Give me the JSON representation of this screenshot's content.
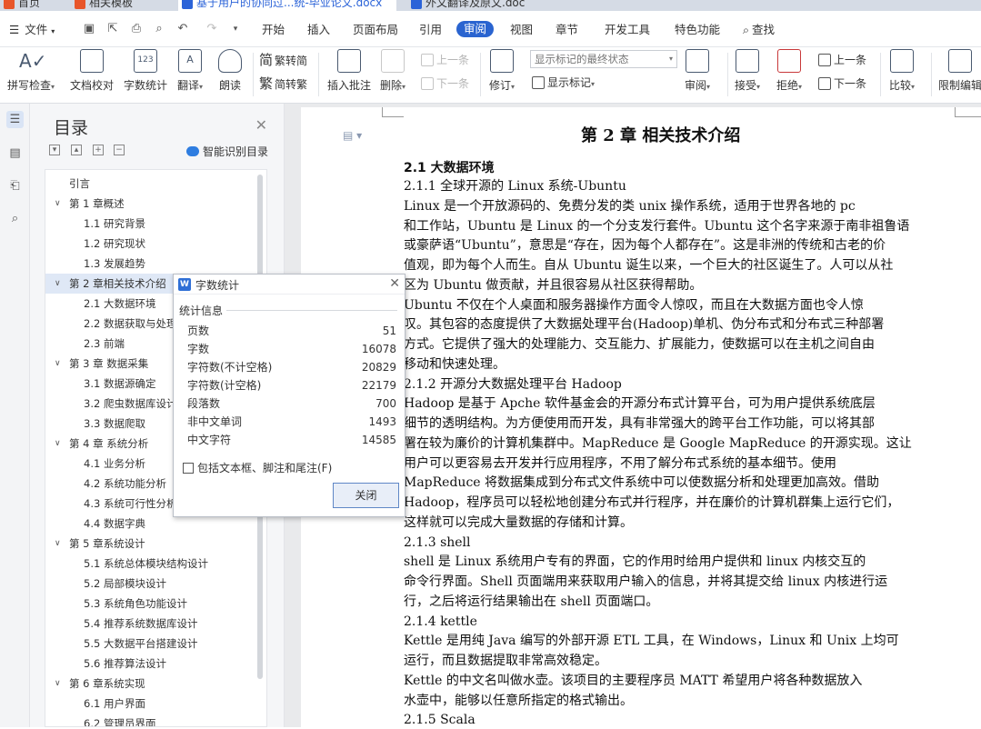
{
  "doc_tabs": [
    {
      "label": "首页",
      "color": "#e8562a"
    },
    {
      "label": "相关模板",
      "color": "#e8562a"
    },
    {
      "label": "基于用户的协同过...统-毕业论文.docx",
      "color": "#2b63d8"
    },
    {
      "label": "外文翻译及原文.doc",
      "color": "#2b63d8"
    }
  ],
  "menu": {
    "file_label": "文件",
    "items": [
      "开始",
      "插入",
      "页面布局",
      "引用",
      "审阅",
      "视图",
      "章节",
      "开发工具",
      "特色功能"
    ],
    "active": "审阅",
    "search_label": "查找"
  },
  "ribbon": {
    "spell_check": "拼写检查",
    "doc_proof": "文档校对",
    "word_count": "字数统计",
    "translate": "翻译",
    "read_aloud": "朗读",
    "trad_simp": "繁转简",
    "simp_trad": "简转繁",
    "insert_comment": "插入批注",
    "delete": "删除",
    "prev_comment": "上一条",
    "next_comment": "下一条",
    "revise": "修订",
    "markup_select_value": "显示标记的最终状态",
    "show_markup": "显示标记",
    "review": "审阅",
    "accept": "接受",
    "reject": "拒绝",
    "prev_change": "上一条",
    "next_change": "下一条",
    "compare": "比较",
    "restrict_edit": "限制编辑"
  },
  "toc": {
    "title": "目录",
    "smart_label": "智能识别目录",
    "items": [
      {
        "label": "引言",
        "level": 0,
        "expandable": false
      },
      {
        "label": "第 1 章概述",
        "level": 0,
        "expandable": true
      },
      {
        "label": "1.1  研究背景",
        "level": 1
      },
      {
        "label": "1.2  研究现状",
        "level": 1
      },
      {
        "label": "1.3  发展趋势",
        "level": 1
      },
      {
        "label": "第 2 章相关技术介绍",
        "level": 0,
        "expandable": true,
        "selected": true
      },
      {
        "label": "2.1  大数据环境",
        "level": 1
      },
      {
        "label": "2.2  数据获取与处理",
        "level": 1
      },
      {
        "label": "2.3 前端",
        "level": 1
      },
      {
        "label": "第 3 章  数据采集",
        "level": 0,
        "expandable": true
      },
      {
        "label": "3.1  数据源确定",
        "level": 1
      },
      {
        "label": "3.2  爬虫数据库设计",
        "level": 1
      },
      {
        "label": "3.3  数据爬取",
        "level": 1
      },
      {
        "label": "第 4 章  系统分析",
        "level": 0,
        "expandable": true
      },
      {
        "label": "4.1  业务分析",
        "level": 1
      },
      {
        "label": "4.2  系统功能分析",
        "level": 1
      },
      {
        "label": "4.3  系统可行性分析",
        "level": 1
      },
      {
        "label": "4.4  数据字典",
        "level": 1
      },
      {
        "label": "第 5 章系统设计",
        "level": 0,
        "expandable": true
      },
      {
        "label": "5.1  系统总体模块结构设计",
        "level": 1
      },
      {
        "label": "5.2  局部模块设计",
        "level": 1
      },
      {
        "label": "5.3  系统角色功能设计",
        "level": 1
      },
      {
        "label": "5.4  推荐系统数据库设计",
        "level": 1
      },
      {
        "label": "5.5  大数据平台搭建设计",
        "level": 1
      },
      {
        "label": "5.6  推荐算法设计",
        "level": 1
      },
      {
        "label": "第 6 章系统实现",
        "level": 0,
        "expandable": true
      },
      {
        "label": "6.1  用户界面",
        "level": 1
      },
      {
        "label": "6.2  管理员界面",
        "level": 1
      }
    ]
  },
  "dialog": {
    "title": "字数统计",
    "section": "统计信息",
    "stats": [
      {
        "label": "页数",
        "value": "51"
      },
      {
        "label": "字数",
        "value": "16078"
      },
      {
        "label": "字符数(不计空格)",
        "value": "20829"
      },
      {
        "label": "字符数(计空格)",
        "value": "22179"
      },
      {
        "label": "段落数",
        "value": "700"
      },
      {
        "label": "非中文单词",
        "value": "1493"
      },
      {
        "label": "中文字符",
        "value": "14585"
      }
    ],
    "checkbox_label": "包括文本框、脚注和尾注(F)",
    "close_label": "关闭"
  },
  "document": {
    "chapter_title": "第 2 章    相关技术介绍",
    "section_2_1": "2.1  大数据环境",
    "lines": [
      "2.1.1  全球开源的 Linux 系统-Ubuntu",
      "        Linux 是一个开放源码的、免费分发的类 unix 操作系统，适用于世界各地的 pc",
      "和工作站，Ubuntu 是 Linux 的一个分支发行套件。Ubuntu 这个名字来源于南非祖鲁语",
      "或豪萨语“Ubuntu”，意思是“存在，因为每个人都存在”。这是非洲的传统和古老的价",
      "值观，即为每个人而生。自从 Ubuntu 诞生以来，一个巨大的社区诞生了。人可以从社",
      "区为 Ubuntu 做贡献，并且很容易从社区获得帮助。",
      "        Ubuntu 不仅在个人桌面和服务器操作方面令人惊叹，而且在大数据方面也令人惊",
      "叹。其包容的态度提供了大数据处理平台(Hadoop)单机、伪分布式和分布式三种部署",
      "方式。它提供了强大的处理能力、交互能力、扩展能力，使数据可以在主机之间自由",
      "移动和快速处理。",
      "2.1.2  开源分大数据处理平台 Hadoop",
      "        Hadoop 是基于 Apche 软件基金会的开源分布式计算平台，可为用户提供系统底层",
      "细节的透明结构。为方便使用而开发，具有非常强大的跨平台工作功能，可以将其部",
      "署在较为廉价的计算机集群中。MapReduce 是 Google MapReduce 的开源实现。这让",
      "用户可以更容易去开发并行应用程序，不用了解分布式系统的基本细节。使用",
      "MapReduce 将数据集成到分布式文件系统中可以使数据分析和处理更加高效。借助",
      "Hadoop，程序员可以轻松地创建分布式并行程序，并在廉价的计算机群集上运行它们，",
      "这样就可以完成大量数据的存储和计算。",
      "2.1.3  shell",
      "        shell 是 Linux 系统用户专有的界面，它的作用时给用户提供和 linux 内核交互的",
      "命令行界面。Shell 页面端用来获取用户输入的信息，并将其提交给 linux 内核进行运",
      "行，之后将运行结果输出在 shell 页面端口。",
      "2.1.4  kettle",
      "        Kettle 是用纯 Java 编写的外部开源 ETL 工具，在 Windows，Linux 和 Unix 上均可",
      "运行，而且数据提取非常高效稳定。",
      "        Kettle 的中文名叫做水壶。该项目的主要程序员 MATT 希望用户将各种数据放入",
      "水壶中，能够以任意所指定的格式输出。",
      "2.1.5 Scala"
    ]
  }
}
